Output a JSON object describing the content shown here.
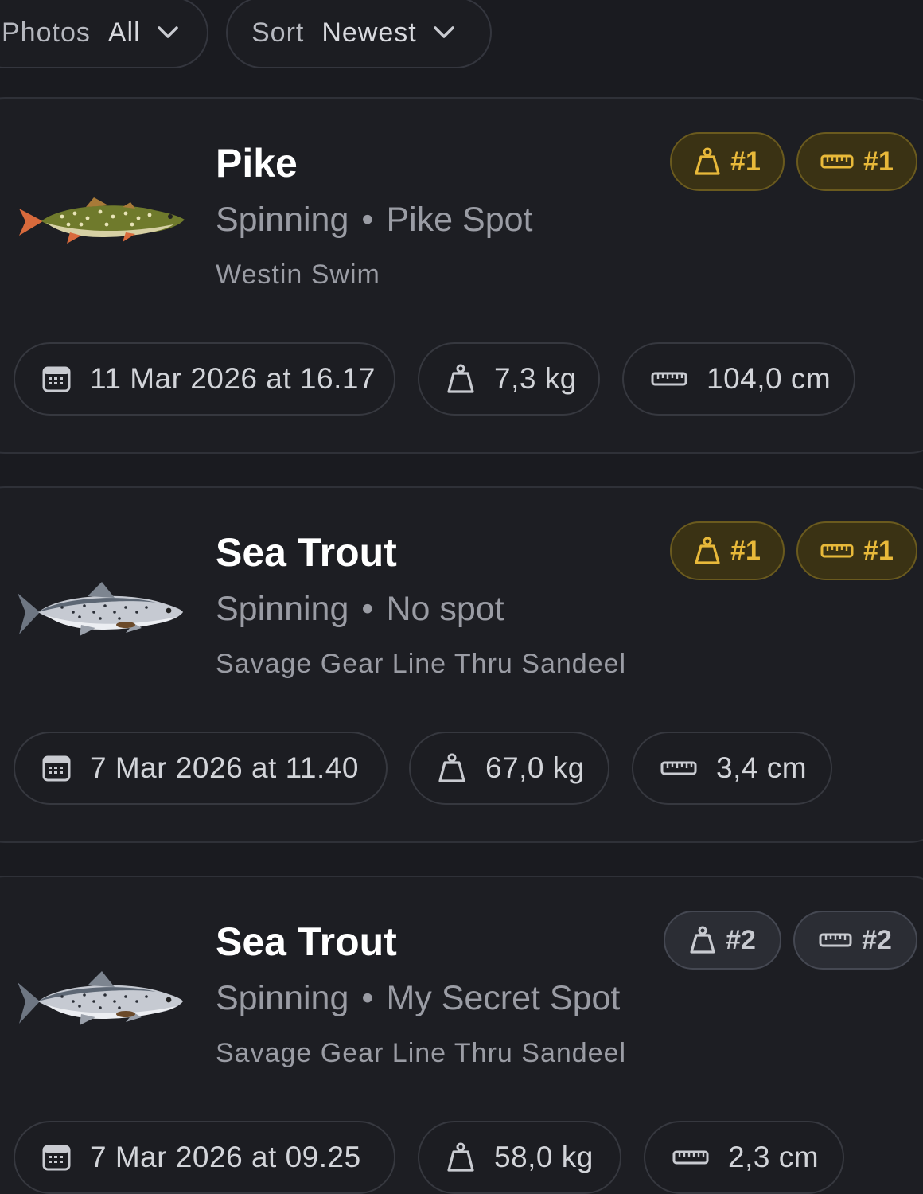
{
  "filters": {
    "photos": {
      "label": "Photos",
      "value": "All"
    },
    "sort": {
      "label": "Sort",
      "value": "Newest"
    }
  },
  "catches": [
    {
      "species": "Pike",
      "method": "Spinning",
      "separator": "•",
      "spot": "Pike Spot",
      "lure": "Westin Swim",
      "rank_weight": "#1",
      "rank_length": "#1",
      "rank_style": "gold",
      "date": "11 Mar 2026 at 16.17",
      "weight": "7,3 kg",
      "length": "104,0 cm",
      "fish_icon": "pike"
    },
    {
      "species": "Sea Trout",
      "method": "Spinning",
      "separator": "•",
      "spot": "No spot",
      "lure": "Savage Gear Line Thru Sandeel",
      "rank_weight": "#1",
      "rank_length": "#1",
      "rank_style": "gold",
      "date": "7 Mar 2026 at 11.40",
      "weight": "67,0 kg",
      "length": "3,4 cm",
      "fish_icon": "sea-trout"
    },
    {
      "species": "Sea Trout",
      "method": "Spinning",
      "separator": "•",
      "spot": "My Secret Spot",
      "lure": "Savage Gear Line Thru Sandeel",
      "rank_weight": "#2",
      "rank_length": "#2",
      "rank_style": "grey",
      "date": "7 Mar 2026 at 09.25",
      "weight": "58,0 kg",
      "length": "2,3 cm",
      "fish_icon": "sea-trout"
    }
  ],
  "colors": {
    "background": "#1a1b20",
    "card": "#1d1e23",
    "gold_accent": "#e8b93a",
    "muted_text": "#9a9ca4"
  }
}
